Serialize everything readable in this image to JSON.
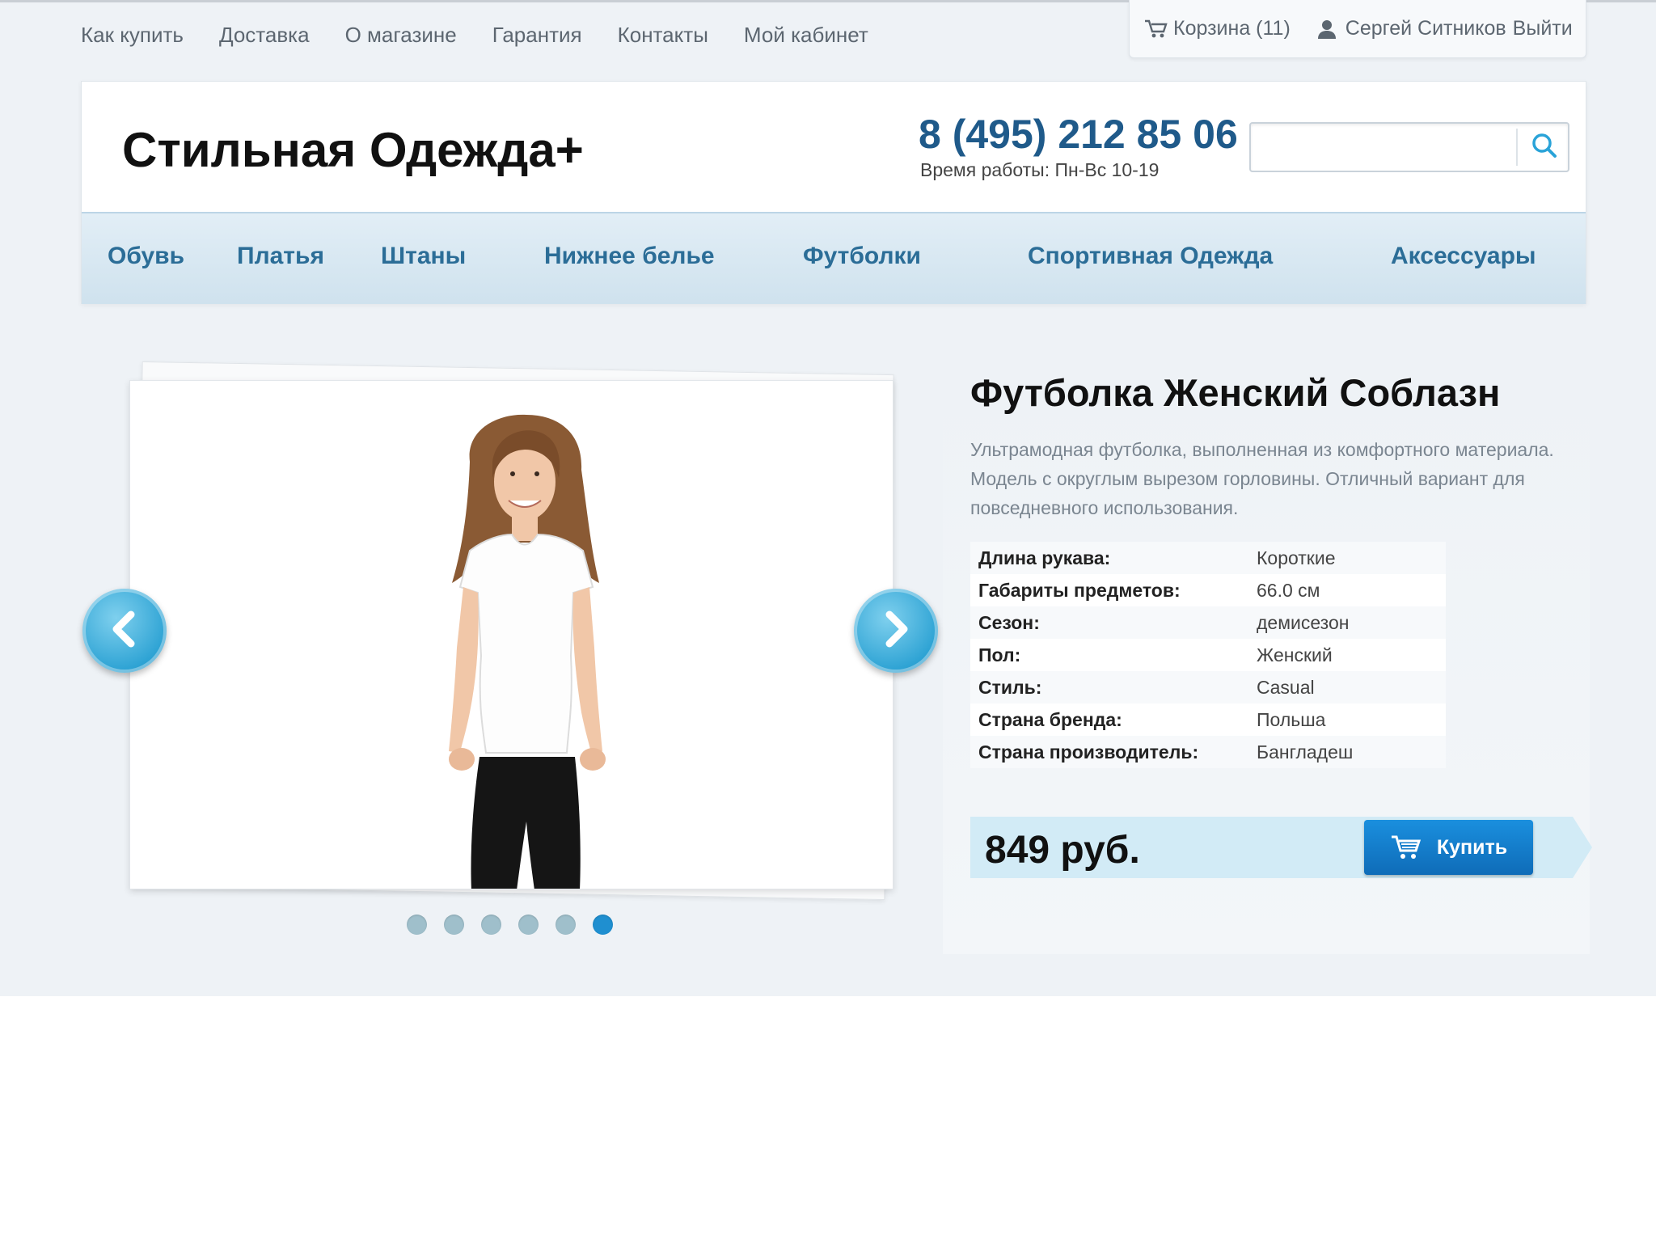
{
  "top_nav": {
    "items": [
      "Как купить",
      "Доставка",
      "О магазине",
      "Гарантия",
      "Контакты",
      "Мой кабинет"
    ]
  },
  "user_box": {
    "cart_label": "Корзина (11)",
    "user_name": "Сергей Ситников",
    "logout_label": "Выйти"
  },
  "header": {
    "logo": "Стильная Одежда+",
    "phone": "8 (495) 212 85 06",
    "hours": "Время работы: Пн-Вс 10-19",
    "search_value": "",
    "search_icon": "search-icon"
  },
  "category_nav": {
    "items": [
      "Обувь",
      "Платья",
      "Штаны",
      "Нижнее белье",
      "Футболки",
      "Спортивная Одежда",
      "Аксессуары"
    ]
  },
  "slider": {
    "slide_count": 6,
    "active_slide": 6,
    "prev_icon": "chevron-left-icon",
    "next_icon": "chevron-right-icon"
  },
  "product": {
    "title": "Футболка Женский Соблазн",
    "description": "Ультрамодная футболка, выполненная из комфортного материала. Модель с округлым вырезом горловины. Отличный вариант для повседневного использования.",
    "specs": [
      {
        "label": "Длина рукава:",
        "value": "Короткие"
      },
      {
        "label": "Габариты предметов:",
        "value": "66.0 см"
      },
      {
        "label": "Сезон:",
        "value": "демисезон"
      },
      {
        "label": "Пол:",
        "value": "Женский"
      },
      {
        "label": "Стиль:",
        "value": "Casual"
      },
      {
        "label": "Страна бренда:",
        "value": "Польша"
      },
      {
        "label": "Страна производитель:",
        "value": "Бангладеш"
      }
    ],
    "price": "849 руб.",
    "buy_label": "Купить"
  },
  "colors": {
    "accent": "#2b6d97",
    "buy_button": "#1a8fde",
    "price_bar": "#d2ebf6"
  }
}
